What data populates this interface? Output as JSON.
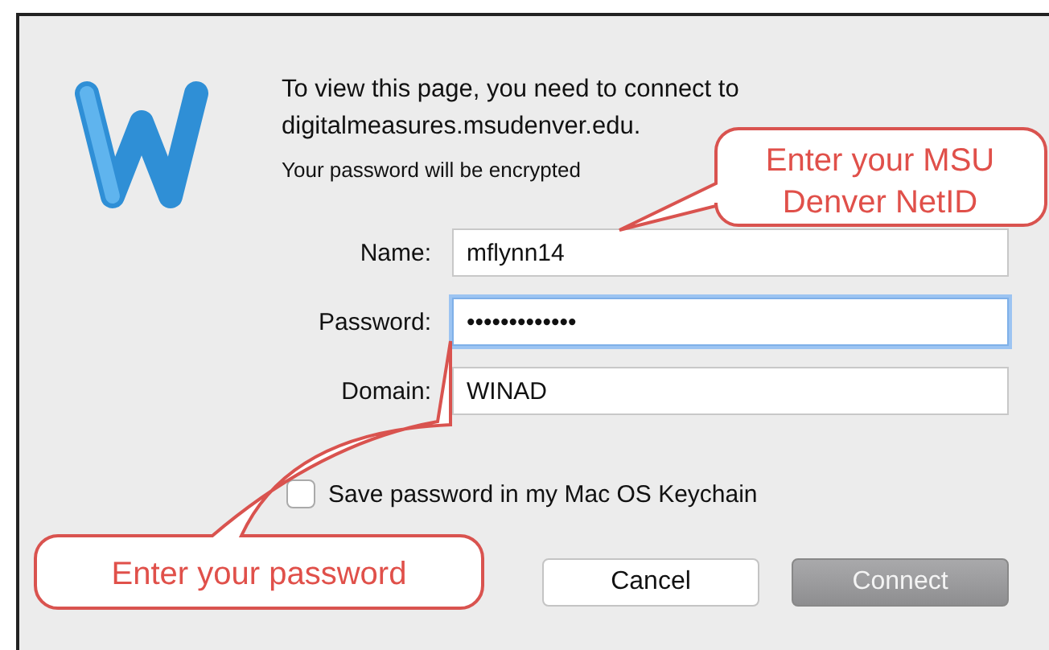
{
  "dialog": {
    "message": "To view this page, you need to connect to digitalmeasures.msudenver.edu.",
    "note": "Your password will be encrypted",
    "fields": [
      {
        "label": "Name:",
        "value": "mflynn14",
        "focused": false
      },
      {
        "label": "Password:",
        "value": "•••••••••••••",
        "focused": true
      },
      {
        "label": "Domain:",
        "value": "WINAD",
        "focused": false
      }
    ],
    "checkbox": {
      "label": "Save password in my Mac OS Keychain",
      "checked": false
    },
    "buttons": [
      {
        "label": "Cancel",
        "kind": "normal"
      },
      {
        "label": "Connect",
        "kind": "default"
      }
    ]
  },
  "callouts": [
    {
      "lines": [
        "Enter your MSU",
        "Denver NetID"
      ]
    },
    {
      "lines": [
        "Enter your password"
      ]
    }
  ]
}
